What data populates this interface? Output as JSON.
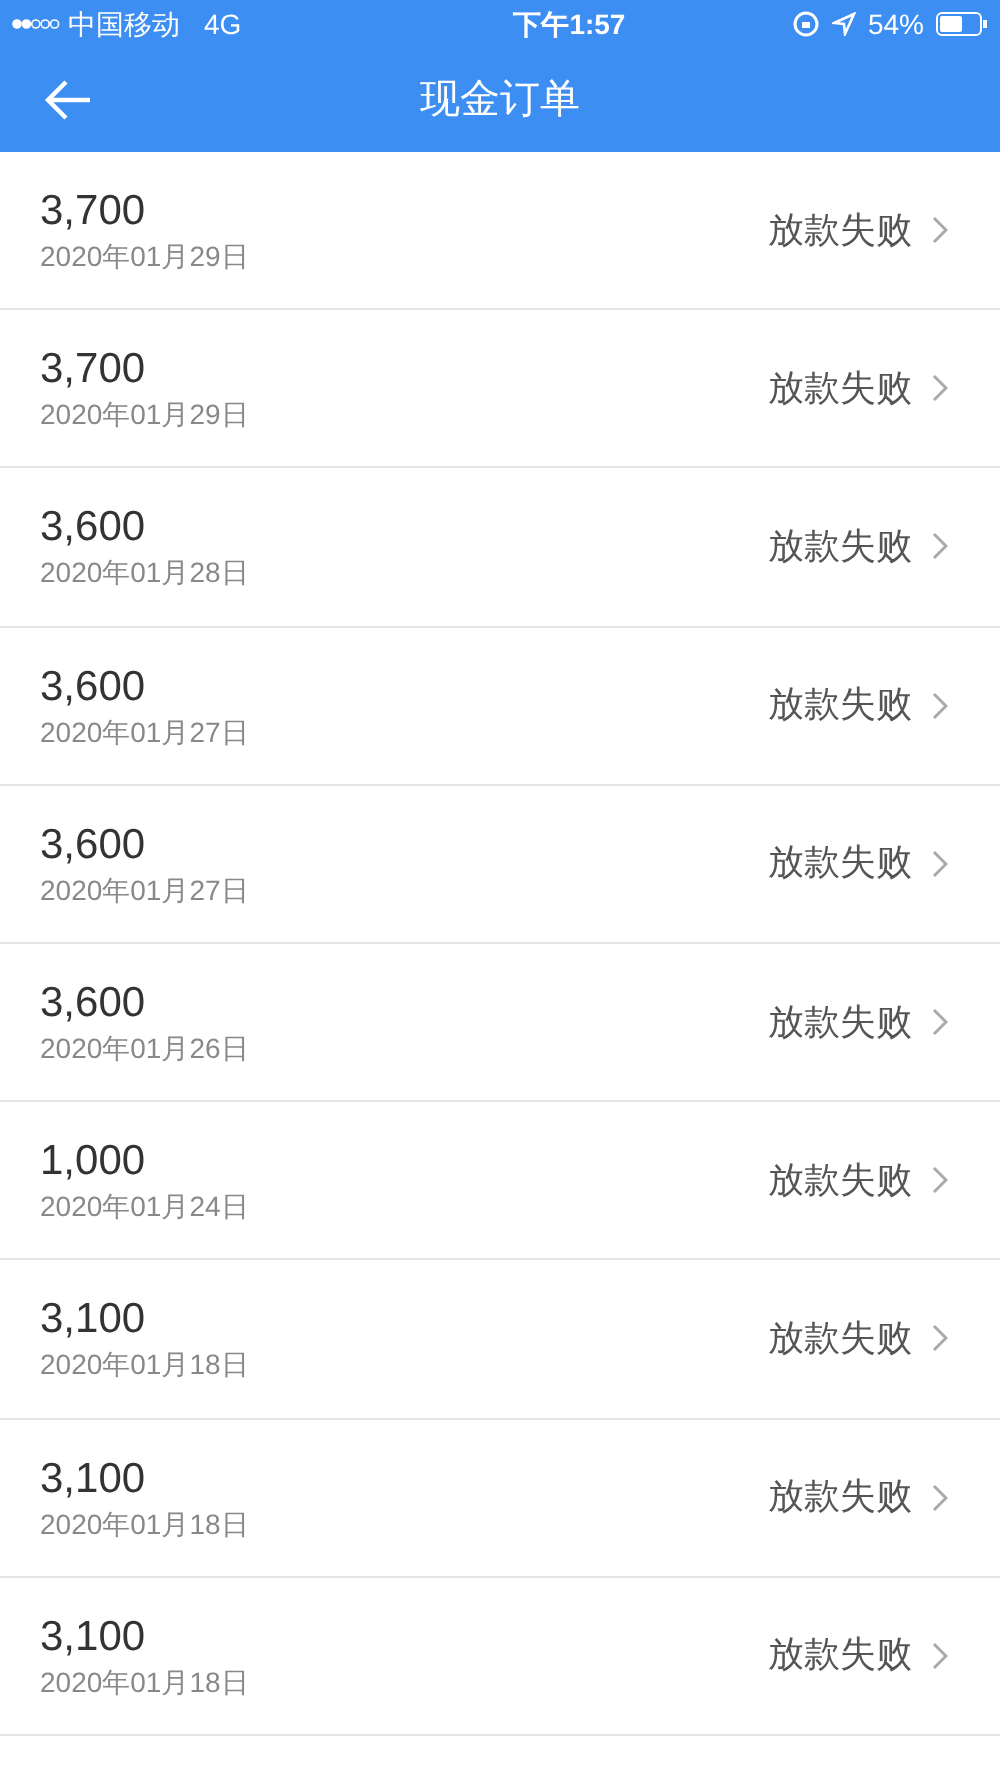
{
  "status_bar": {
    "carrier": "中国移动",
    "network": "4G",
    "time": "下午1:57",
    "battery": "54%"
  },
  "header": {
    "title": "现金订单"
  },
  "orders": [
    {
      "amount": "3,700",
      "date": "2020年01月29日",
      "status": "放款失败"
    },
    {
      "amount": "3,700",
      "date": "2020年01月29日",
      "status": "放款失败"
    },
    {
      "amount": "3,600",
      "date": "2020年01月28日",
      "status": "放款失败"
    },
    {
      "amount": "3,600",
      "date": "2020年01月27日",
      "status": "放款失败"
    },
    {
      "amount": "3,600",
      "date": "2020年01月27日",
      "status": "放款失败"
    },
    {
      "amount": "3,600",
      "date": "2020年01月26日",
      "status": "放款失败"
    },
    {
      "amount": "1,000",
      "date": "2020年01月24日",
      "status": "放款失败"
    },
    {
      "amount": "3,100",
      "date": "2020年01月18日",
      "status": "放款失败"
    },
    {
      "amount": "3,100",
      "date": "2020年01月18日",
      "status": "放款失败"
    },
    {
      "amount": "3,100",
      "date": "2020年01月18日",
      "status": "放款失败"
    }
  ]
}
